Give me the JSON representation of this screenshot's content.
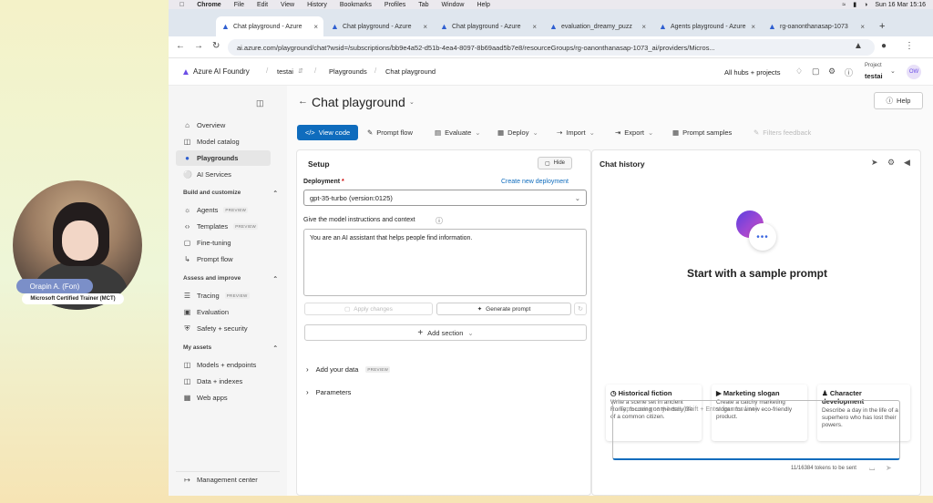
{
  "menubar": {
    "items": [
      "Chrome",
      "File",
      "Edit",
      "View",
      "History",
      "Bookmarks",
      "Profiles",
      "Tab",
      "Window",
      "Help"
    ],
    "datetime": "Sun 16 Mar 15:16"
  },
  "browser": {
    "tabs": [
      {
        "label": "Chat playground - Azure",
        "active": true
      },
      {
        "label": "Chat playground - Azure",
        "active": false
      },
      {
        "label": "Chat playground - Azure",
        "active": false
      },
      {
        "label": "evaluation_dreamy_puzz",
        "active": false
      },
      {
        "label": "Agents playground - Azure",
        "active": false
      },
      {
        "label": "rg-oanonthanasap-1073",
        "active": false
      }
    ],
    "url": "ai.azure.com/playground/chat?wsid=/subscriptions/bb9e4a52-d51b-4ea4-8097-8b69aad5b7e8/resourceGroups/rg-oanonthanasap-1073_ai/providers/Micros..."
  },
  "header": {
    "app_name": "Azure AI Foundry",
    "crumbs": [
      "testai",
      "Playgrounds",
      "Chat playground"
    ],
    "hubs_link": "All hubs + projects",
    "project_label": "Project",
    "project_name": "testai",
    "avatar": "OW"
  },
  "sidebar": {
    "top_items": [
      {
        "label": "Overview",
        "icon": "overview-icon"
      },
      {
        "label": "Model catalog",
        "icon": "catalog-icon"
      },
      {
        "label": "Playgrounds",
        "icon": "playground-icon",
        "selected": true
      },
      {
        "label": "AI Services",
        "icon": "services-icon"
      }
    ],
    "build_section": "Build and customize",
    "build_items": [
      {
        "label": "Agents",
        "badge": "PREVIEW"
      },
      {
        "label": "Templates",
        "badge": "PREVIEW"
      },
      {
        "label": "Fine-tuning"
      },
      {
        "label": "Prompt flow"
      }
    ],
    "assess_section": "Assess and improve",
    "assess_items": [
      {
        "label": "Tracing",
        "badge": "PREVIEW"
      },
      {
        "label": "Evaluation"
      },
      {
        "label": "Safety + security"
      }
    ],
    "assets_section": "My assets",
    "assets_items": [
      {
        "label": "Models + endpoints"
      },
      {
        "label": "Data + indexes"
      },
      {
        "label": "Web apps"
      }
    ],
    "management": "Management center"
  },
  "main": {
    "title": "Chat playground",
    "help": "Help",
    "toolbar": {
      "view_code": "View code",
      "prompt_flow": "Prompt flow",
      "evaluate": "Evaluate",
      "deploy": "Deploy",
      "import": "Import",
      "export": "Export",
      "prompt_samples": "Prompt samples",
      "filters_feedback": "Filters feedback"
    },
    "setup": {
      "title": "Setup",
      "hide": "Hide",
      "deployment_label": "Deployment",
      "create_link": "Create new deployment",
      "deployment_value": "gpt-35-turbo (version:0125)",
      "instructions_label": "Give the model instructions and context",
      "instructions_value": "You are an AI assistant that helps people find information.",
      "apply_changes": "Apply changes",
      "generate_prompt": "Generate prompt",
      "add_section": "Add section",
      "add_your_data": "Add your data",
      "add_your_data_badge": "PREVIEW",
      "parameters": "Parameters"
    },
    "chat": {
      "title": "Chat history",
      "heading": "Start with a sample prompt",
      "cards": [
        {
          "title": "Historical fiction",
          "text": "Write a scene set in ancient Rome, focusing on the daily life of a common citizen."
        },
        {
          "title": "Marketing slogan",
          "text": "Create a catchy marketing slogan for a new eco-friendly product."
        },
        {
          "title": "Character development",
          "text": "Describe a day in the life of a superhero who has lost their powers."
        }
      ],
      "input_placeholder": "Type user query here. (Shift + Enter for new line)",
      "token_count": "11/16384 tokens to be sent"
    }
  },
  "webcam": {
    "name": "Orapin A. (Fon)",
    "title": "Microsoft Certified Trainer (MCT)"
  },
  "colors": {
    "accent": "#0f6cbd",
    "icon_purple": "#6b4ee6"
  }
}
